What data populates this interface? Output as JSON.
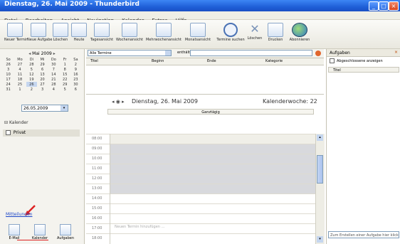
{
  "window": {
    "title": "Dienstag, 26. Mai 2009 - Thunderbird"
  },
  "menu": [
    "Datei",
    "Bearbeiten",
    "Ansicht",
    "Navigation",
    "Kalender",
    "Extras",
    "Hilfe"
  ],
  "toolbar": [
    "Neuer Termin",
    "Neue Aufgabe",
    "Löschen",
    "Heute",
    "Tagesansicht",
    "Wochenansicht",
    "Mehrwochenansicht",
    "Monatsansicht",
    "Termine suchen",
    "Löschen",
    "Drucken",
    "Abonnieren"
  ],
  "minical": {
    "month": "Mai 2009",
    "weekdays": [
      "So",
      "Mo",
      "Di",
      "Mi",
      "Do",
      "Fr",
      "Sa"
    ],
    "weeks": [
      [
        "26",
        "27",
        "28",
        "29",
        "30",
        "1",
        "2"
      ],
      [
        "3",
        "4",
        "5",
        "6",
        "7",
        "8",
        "9"
      ],
      [
        "10",
        "11",
        "12",
        "13",
        "14",
        "15",
        "16"
      ],
      [
        "17",
        "18",
        "19",
        "20",
        "21",
        "22",
        "23"
      ],
      [
        "24",
        "25",
        "26",
        "27",
        "28",
        "29",
        "30"
      ],
      [
        "31",
        "1",
        "2",
        "3",
        "4",
        "5",
        "6"
      ]
    ],
    "date_field": "26.05.2009"
  },
  "left": {
    "calendars_header": "Kalender",
    "calendar_item": "Privat",
    "link": "Mitteilungen",
    "modes": [
      "E-Mail",
      "Kalender",
      "Aufgaben"
    ]
  },
  "filter": {
    "combo": "Alle Termine",
    "label": "enthält"
  },
  "events_header": [
    "Titel",
    "Beginn",
    "Ende",
    "Kategorie"
  ],
  "day": {
    "nav": "◂ ◉ ▸",
    "date": "Dienstag, 26. Mai 2009",
    "week": "Kalenderwoche: 22",
    "allday": "Ganztägig",
    "add_hint": "Neuen Termin hinzufügen …",
    "times": [
      "08:00",
      "09:00",
      "10:00",
      "11:00",
      "12:00",
      "13:00",
      "14:00",
      "15:00",
      "16:00",
      "17:00",
      "18:00"
    ]
  },
  "tasks": {
    "title": "Aufgaben",
    "show_done": "Abgeschlossene anzeigen",
    "column": "Titel",
    "new_task": "Zum Erstellen einer Aufgabe hier klicken"
  }
}
